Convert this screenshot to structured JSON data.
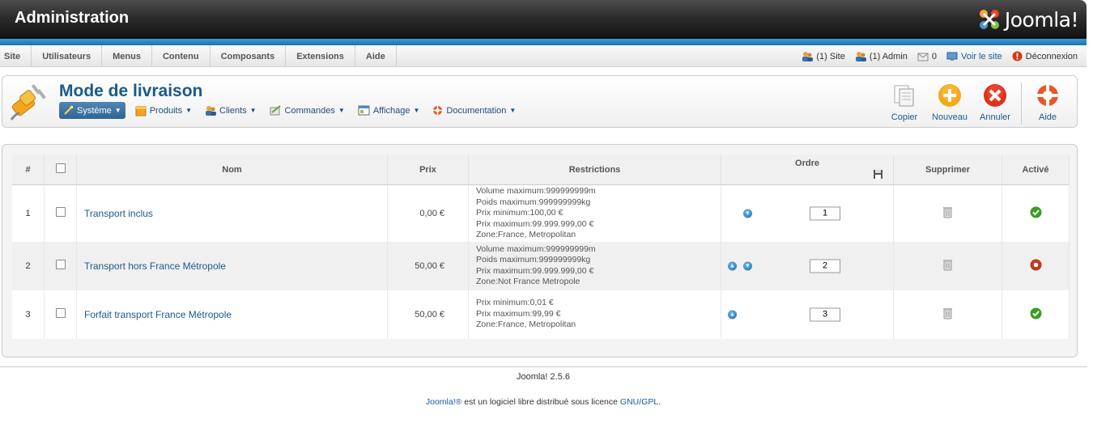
{
  "header": {
    "title": "Administration",
    "logo_text": "Joomla!"
  },
  "menu": {
    "items": [
      "Site",
      "Utilisateurs",
      "Menus",
      "Contenu",
      "Composants",
      "Extensions",
      "Aide"
    ]
  },
  "status": {
    "site": "(1) Site",
    "admin": "(1) Admin",
    "messages": "0",
    "view_site": "Voir le site",
    "logout": "Déconnexion"
  },
  "toolbar": {
    "title": "Mode de livraison",
    "submenu": [
      "Système",
      "Produits",
      "Clients",
      "Commandes",
      "Affichage",
      "Documentation"
    ],
    "buttons": {
      "copy": "Copier",
      "new": "Nouveau",
      "cancel": "Annuler",
      "help": "Aide"
    }
  },
  "table": {
    "headers": {
      "num": "#",
      "name": "Nom",
      "price": "Prix",
      "restrictions": "Restrictions",
      "order": "Ordre",
      "delete": "Supprimer",
      "active": "Activé"
    },
    "rows": [
      {
        "num": "1",
        "name": "Transport inclus",
        "price": "0,00 €",
        "restrictions": [
          "Volume maximum:999999999m",
          "Poids maximum:999999999kg",
          "Prix minimum:100,00 €",
          "Prix maximum:99.999.999,00 €",
          "Zone:France, Metropolitan"
        ],
        "order": "1",
        "active": true
      },
      {
        "num": "2",
        "name": "Transport hors France Métropole",
        "price": "50,00 €",
        "restrictions": [
          "Volume maximum:999999999m",
          "Poids maximum:999999999kg",
          "Prix maximum:99.999.999,00 €",
          "Zone:Not France Metropole"
        ],
        "order": "2",
        "active": false
      },
      {
        "num": "3",
        "name": "Forfait transport France Métropole",
        "price": "50,00 €",
        "restrictions": [
          "Prix minimum:0,01 €",
          "Prix maximum:99,99 €",
          "Zone:France, Metropolitan"
        ],
        "order": "3",
        "active": true
      }
    ]
  },
  "footer": {
    "version": "Joomla! 2.5.6",
    "licence_link1": "Joomla!®",
    "licence_text": " est un logiciel libre distribué sous licence ",
    "licence_link2": "GNU/GPL",
    "licence_end": "."
  },
  "colors": {
    "accent": "#1a5a8a",
    "strip": "#1a73b5",
    "active_green": "#3a9d23",
    "inactive_red": "#c0391b"
  }
}
